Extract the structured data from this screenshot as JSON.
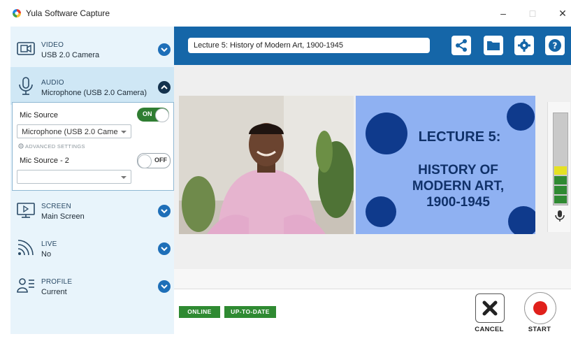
{
  "window": {
    "title": "Yula Software Capture",
    "minimize": "–",
    "maximize": "□",
    "close": "✕"
  },
  "sidebar": {
    "items": [
      {
        "title": "VIDEO",
        "value": "USB 2.0 Camera",
        "icon": "camera-icon"
      },
      {
        "title": "AUDIO",
        "value": "Microphone (USB 2.0 Camera)",
        "icon": "microphone-icon"
      },
      {
        "title": "SCREEN",
        "value": "Main Screen",
        "icon": "screen-icon"
      },
      {
        "title": "LIVE",
        "value": "No",
        "icon": "broadcast-icon"
      },
      {
        "title": "PROFILE",
        "value": "Current",
        "icon": "profile-icon"
      }
    ]
  },
  "audio": {
    "source_label": "Mic Source",
    "source_toggle": "ON",
    "source_value": "Microphone (USB 2.0 Came",
    "advanced_label": "ADVANCED SETTINGS",
    "source2_label": "Mic Source - 2",
    "source2_toggle": "OFF",
    "source2_value": ""
  },
  "toolbar": {
    "title_value": "Lecture 5: History of Modern Art, 1900-1945",
    "share_icon": "share-icon",
    "folder_icon": "folder-icon",
    "settings_icon": "gear-icon",
    "help_icon": "help-icon"
  },
  "slide": {
    "line1": "LECTURE 5:",
    "line2": "HISTORY OF",
    "line3": "MODERN ART,",
    "line4": "1900-1945",
    "bg_color": "#8fb1f2",
    "text_color": "#103169"
  },
  "meter": {
    "level": 0.4
  },
  "status": {
    "online": "ONLINE",
    "uptodate": "UP-TO-DATE"
  },
  "controls": {
    "cancel": "CANCEL",
    "start": "START"
  },
  "colors": {
    "accent": "#1566a8",
    "status_green": "#2f8a32",
    "record_red": "#e0201b"
  }
}
